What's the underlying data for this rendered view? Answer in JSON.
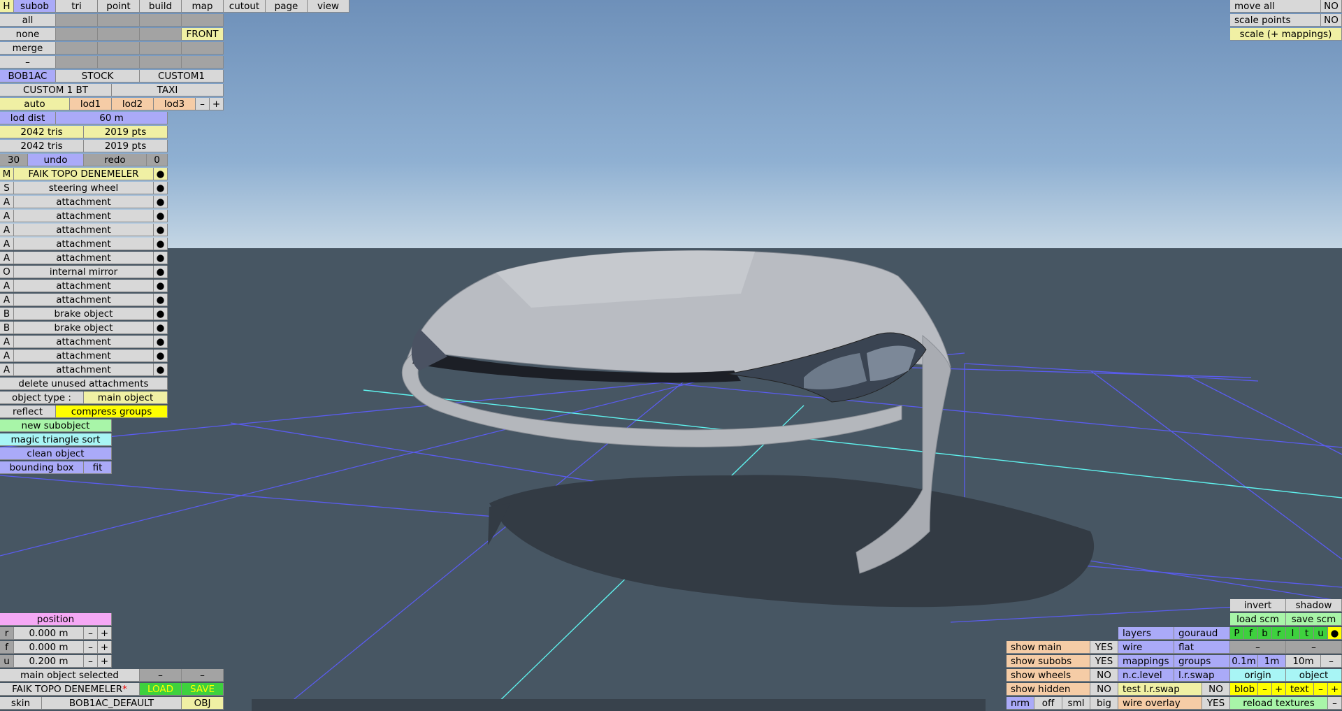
{
  "top_tabs": [
    "H",
    "subob",
    "tri",
    "point",
    "build",
    "map",
    "cutout",
    "page",
    "view"
  ],
  "select_rows": [
    "all",
    "none",
    "merge",
    "–"
  ],
  "front_label": "FRONT",
  "skins": [
    "BOB1AC",
    "STOCK",
    "CUSTOM1"
  ],
  "custom_row": [
    "CUSTOM 1 BT",
    "TAXI"
  ],
  "lod": {
    "auto": "auto",
    "lods": [
      "lod1",
      "lod2",
      "lod3"
    ],
    "minus": "–",
    "plus": "+",
    "dist_label": "lod dist",
    "dist_value": "60 m"
  },
  "stats": {
    "tris1": "2042 tris",
    "pts1": "2019 pts",
    "tris2": "2042 tris",
    "pts2": "2019 pts"
  },
  "history": {
    "count": "30",
    "undo": "undo",
    "redo": "redo",
    "redo_count": "0"
  },
  "objects": [
    {
      "type": "M",
      "name": "FAIK TOPO DENEMELER",
      "dot": "●"
    },
    {
      "type": "S",
      "name": "steering wheel",
      "dot": "●"
    },
    {
      "type": "A",
      "name": "attachment",
      "dot": "●"
    },
    {
      "type": "A",
      "name": "attachment",
      "dot": "●"
    },
    {
      "type": "A",
      "name": "attachment",
      "dot": "●"
    },
    {
      "type": "A",
      "name": "attachment",
      "dot": "●"
    },
    {
      "type": "A",
      "name": "attachment",
      "dot": "●"
    },
    {
      "type": "O",
      "name": "internal mirror",
      "dot": "●"
    },
    {
      "type": "A",
      "name": "attachment",
      "dot": "●"
    },
    {
      "type": "A",
      "name": "attachment",
      "dot": "●"
    },
    {
      "type": "B",
      "name": "brake object",
      "dot": "●"
    },
    {
      "type": "B",
      "name": "brake object",
      "dot": "●"
    },
    {
      "type": "A",
      "name": "attachment",
      "dot": "●"
    },
    {
      "type": "A",
      "name": "attachment",
      "dot": "●"
    },
    {
      "type": "A",
      "name": "attachment",
      "dot": "●"
    }
  ],
  "obj_actions": {
    "delete_unused": "delete unused attachments",
    "object_type_label": "object type :",
    "object_type_value": "main object",
    "reflect": "reflect",
    "compress": "compress groups",
    "new_subobject": "new subobject",
    "magic_sort": "magic triangle sort",
    "clean": "clean object",
    "bounding_box": "bounding box",
    "fit": "fit"
  },
  "position": {
    "title": "position",
    "rows": [
      {
        "axis": "r",
        "value": "0.000 m"
      },
      {
        "axis": "f",
        "value": "0.000 m"
      },
      {
        "axis": "u",
        "value": "0.200 m"
      }
    ],
    "minus": "–",
    "plus": "+"
  },
  "bottom_left": {
    "selected": "main object selected",
    "minus": "–",
    "filename": "FAIK TOPO DENEMELER",
    "modified_mark": "*",
    "load": "LOAD",
    "save": "SAVE",
    "skin_label": "skin",
    "skin_value": "BOB1AC_DEFAULT",
    "obj": "OBJ"
  },
  "top_right": {
    "move_all": "move all",
    "move_all_val": "NO",
    "scale_points": "scale points",
    "scale_points_val": "NO",
    "scale_mappings": "scale (+ mappings)"
  },
  "bottom_right": {
    "invert": "invert",
    "shadow": "shadow",
    "load_scm": "load scm",
    "save_scm": "save scm",
    "layers": "layers",
    "gouraud": "gouraud",
    "flags": [
      "P",
      "f",
      "b",
      "r",
      "l",
      "t",
      "u"
    ],
    "dot": "●",
    "wire": "wire",
    "flat": "flat",
    "dash": "–",
    "show_main": "show main",
    "show_main_val": "YES",
    "show_subobs": "show subobs",
    "show_subobs_val": "YES",
    "mappings": "mappings",
    "groups": "groups",
    "steps": [
      "0.1m",
      "1m",
      "10m"
    ],
    "show_wheels": "show wheels",
    "show_wheels_val": "NO",
    "nc_level": "n.c.level",
    "lr_swap": "l.r.swap",
    "origin": "origin",
    "object": "object",
    "show_hidden": "show hidden",
    "show_hidden_val": "NO",
    "test_lr_swap": "test l.r.swap",
    "test_lr_swap_val": "NO",
    "blob": "blob",
    "text": "text",
    "minus": "–",
    "plus": "+",
    "sizes": [
      "nrm",
      "off",
      "sml",
      "big"
    ],
    "wire_overlay": "wire overlay",
    "wire_overlay_val": "YES",
    "reload_textures": "reload textures"
  },
  "colors": {
    "blue": "#aaaaf8",
    "yellow": "#f0f0a4",
    "orange": "#f5cca6",
    "green": "#a8f5a8",
    "cyan": "#a8f5f5",
    "pink": "#f5a8f5"
  }
}
